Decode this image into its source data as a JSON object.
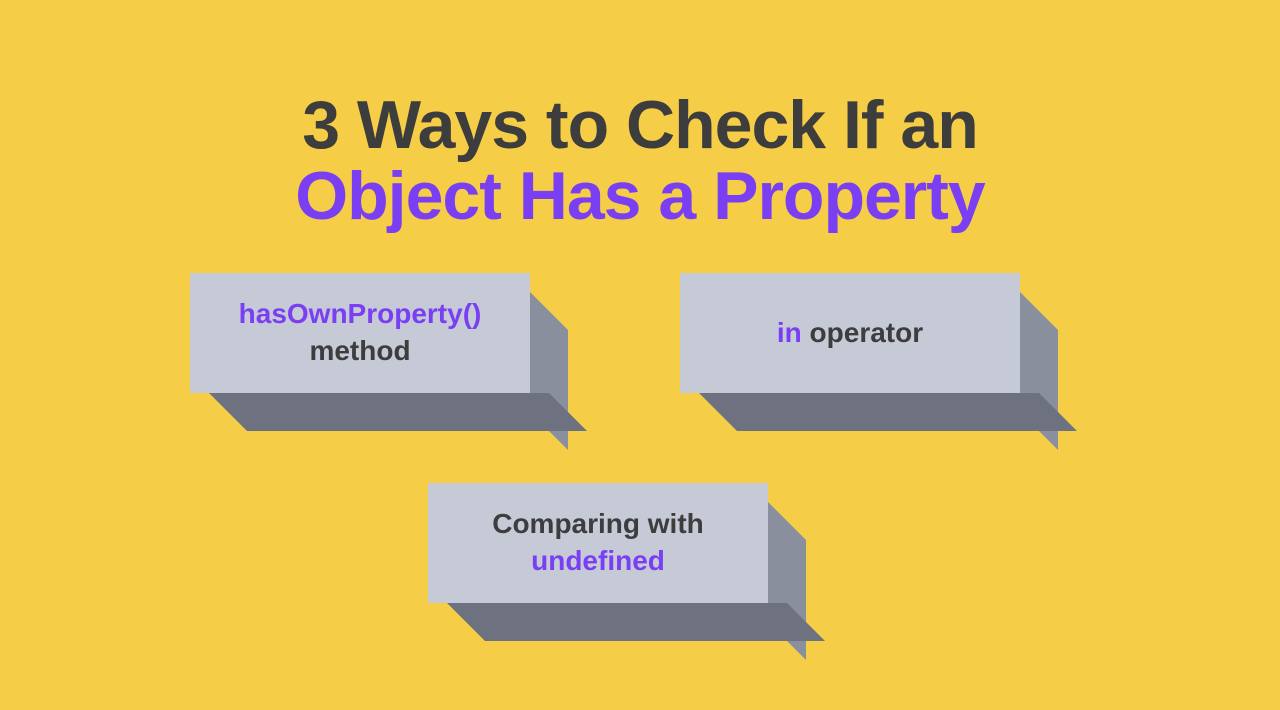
{
  "title": {
    "line1": "3 Ways to Check If an",
    "line2": "Object Has a Property"
  },
  "boxes": {
    "b1": {
      "keyword": "hasOwnProperty()",
      "rest": "method"
    },
    "b2": {
      "keyword": "in",
      "rest": " operator"
    },
    "b3": {
      "top": "Comparing with",
      "keyword": "undefined"
    }
  }
}
